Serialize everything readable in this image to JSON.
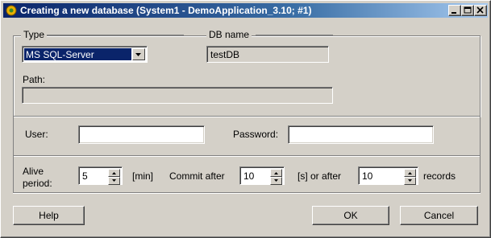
{
  "window": {
    "title": "Creating a new database (System1 - DemoApplication_3.10; #1)"
  },
  "type_group": {
    "legend": "Type",
    "selected": "MS SQL-Server"
  },
  "dbname_group": {
    "legend": "DB name",
    "value": "testDB"
  },
  "path": {
    "label": "Path:",
    "value": ""
  },
  "credentials": {
    "user_label": "User:",
    "user_value": "",
    "password_label": "Password:",
    "password_value": ""
  },
  "timing": {
    "alive_label_1": "Alive",
    "alive_label_2": "period:",
    "alive_value": "5",
    "alive_unit": "[min]",
    "commit_label": "Commit after",
    "commit_value": "10",
    "commit_unit": "[s] or after",
    "records_value": "10",
    "records_label": "records"
  },
  "buttons": {
    "help": "Help",
    "ok": "OK",
    "cancel": "Cancel"
  }
}
